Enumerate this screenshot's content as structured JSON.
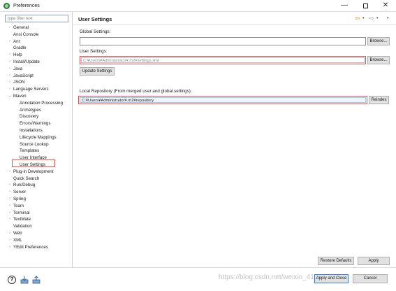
{
  "window": {
    "title": "Preferences",
    "minimize": "—",
    "close": "✕"
  },
  "sidebar": {
    "filter_placeholder": "type filter text",
    "items": [
      {
        "label": "General",
        "level": 0,
        "arrow": "›"
      },
      {
        "label": "Ansi Console",
        "level": 0,
        "arrow": ""
      },
      {
        "label": "Ant",
        "level": 0,
        "arrow": "›"
      },
      {
        "label": "Gradle",
        "level": 0,
        "arrow": ""
      },
      {
        "label": "Help",
        "level": 0,
        "arrow": "›"
      },
      {
        "label": "Install/Update",
        "level": 0,
        "arrow": "›"
      },
      {
        "label": "Java",
        "level": 0,
        "arrow": "›"
      },
      {
        "label": "JavaScript",
        "level": 0,
        "arrow": "›"
      },
      {
        "label": "JSON",
        "level": 0,
        "arrow": "›"
      },
      {
        "label": "Language Servers",
        "level": 0,
        "arrow": "›"
      },
      {
        "label": "Maven",
        "level": 0,
        "arrow": "⌄"
      },
      {
        "label": "Annotation Processing",
        "level": 1,
        "arrow": ""
      },
      {
        "label": "Archetypes",
        "level": 1,
        "arrow": ""
      },
      {
        "label": "Discovery",
        "level": 1,
        "arrow": ""
      },
      {
        "label": "Errors/Warnings",
        "level": 1,
        "arrow": ""
      },
      {
        "label": "Installations",
        "level": 1,
        "arrow": ""
      },
      {
        "label": "Lifecycle Mappings",
        "level": 1,
        "arrow": ""
      },
      {
        "label": "Source Lookup",
        "level": 1,
        "arrow": ""
      },
      {
        "label": "Templates",
        "level": 1,
        "arrow": ""
      },
      {
        "label": "User Interface",
        "level": 1,
        "arrow": ""
      },
      {
        "label": "User Settings",
        "level": 1,
        "arrow": ""
      },
      {
        "label": "Plug-in Development",
        "level": 0,
        "arrow": "›"
      },
      {
        "label": "Quick Search",
        "level": 0,
        "arrow": ""
      },
      {
        "label": "Run/Debug",
        "level": 0,
        "arrow": "›"
      },
      {
        "label": "Server",
        "level": 0,
        "arrow": "›"
      },
      {
        "label": "Spring",
        "level": 0,
        "arrow": "›"
      },
      {
        "label": "Team",
        "level": 0,
        "arrow": "›"
      },
      {
        "label": "Terminal",
        "level": 0,
        "arrow": "›"
      },
      {
        "label": "TextMate",
        "level": 0,
        "arrow": "›"
      },
      {
        "label": "Validation",
        "level": 0,
        "arrow": ""
      },
      {
        "label": "Web",
        "level": 0,
        "arrow": "›"
      },
      {
        "label": "XML",
        "level": 0,
        "arrow": "›"
      },
      {
        "label": "YEdit Preferences",
        "level": 0,
        "arrow": "›"
      }
    ]
  },
  "page": {
    "title": "User Settings",
    "nav_back_icon": "⇦",
    "nav_forward_icon": "⇨",
    "nav_dropdown": "▾",
    "nav_menu": "▾",
    "global_settings_label": "Global Settings:",
    "global_settings_value": "",
    "browse_label": "Browse...",
    "user_settings_label": "User Settings:",
    "user_settings_value": "C:¥Users¥Administrator¥.m2¥settings.xml",
    "update_settings_label": "Update Settings",
    "local_repo_label": "Local Repository (From merged user and global settings):",
    "local_repo_value": "C:¥Users¥Administrator¥.m2¥repository",
    "reindex_label": "Reindex",
    "restore_defaults_label": "Restore Defaults",
    "apply_label": "Apply"
  },
  "footer": {
    "help_icon": "?",
    "apply_close_label": "Apply and Close",
    "cancel_label": "Cancel",
    "watermark": "https://blog.csdn.net/weixin_41..."
  },
  "colors": {
    "highlight_red": "#e05050",
    "focus_blue": "#3a7bd5",
    "nav_orange": "#d28a1a"
  }
}
